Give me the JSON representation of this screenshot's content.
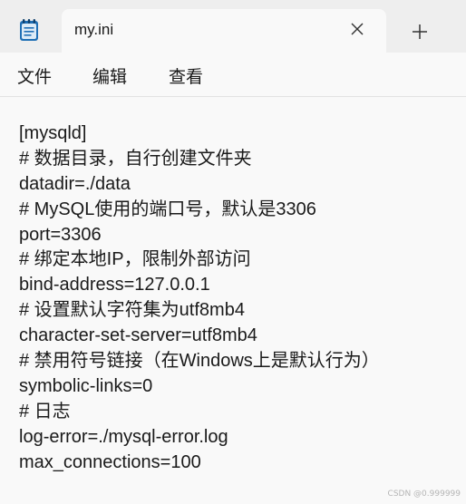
{
  "window": {
    "app_icon": "notepad-icon",
    "tab": {
      "title": "my.ini",
      "close_icon": "close-icon"
    },
    "new_tab_icon": "plus-icon"
  },
  "menu": {
    "items": [
      "文件",
      "编辑",
      "查看"
    ]
  },
  "editor": {
    "lines": [
      "[mysqld]",
      "# 数据目录，自行创建文件夹",
      "datadir=./data",
      "# MySQL使用的端口号，默认是3306",
      "port=3306",
      "# 绑定本地IP，限制外部访问",
      "bind-address=127.0.0.1",
      "# 设置默认字符集为utf8mb4",
      "character-set-server=utf8mb4",
      "# 禁用符号链接（在Windows上是默认行为）",
      "symbolic-links=0",
      "# 日志",
      "log-error=./mysql-error.log",
      "max_connections=100"
    ]
  },
  "watermark": "CSDN @0.999999",
  "colors": {
    "tabstrip_bg": "#eeeeee",
    "editor_bg": "#f9f9f9",
    "text": "#1a1a1a",
    "icon_blue": "#1f6fb5"
  }
}
